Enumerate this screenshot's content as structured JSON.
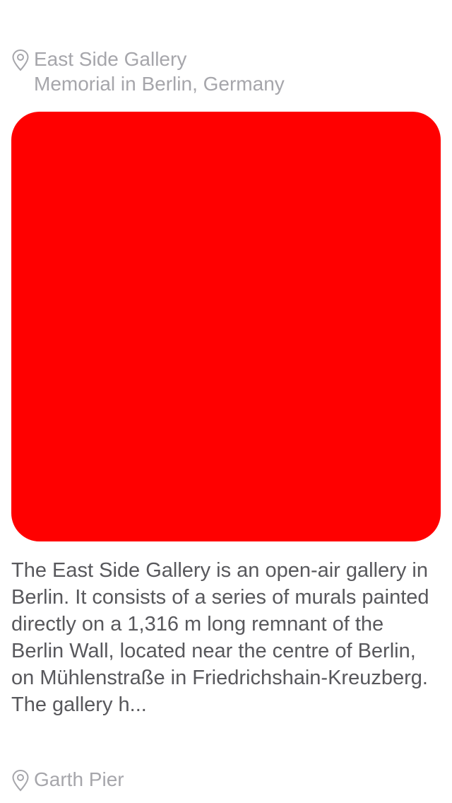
{
  "cards": [
    {
      "title": "East Side Gallery",
      "subtitle": "Memorial in Berlin, Germany",
      "location_icon": "map-pin-icon",
      "image_color": "#ff0000",
      "description": "The East Side Gallery is an open-air gallery in Berlin. It consists of a series of murals painted directly on a 1,316 m long remnant of the Berlin Wall, located near the centre of Berlin, on Mühlenstraße in Friedrichshain-Kreuzberg. The gallery h..."
    },
    {
      "title": "Garth Pier",
      "location_icon": "map-pin-icon"
    }
  ],
  "colors": {
    "header_text": "#a6a6ab",
    "body_text": "#58585c",
    "background": "#ffffff"
  }
}
